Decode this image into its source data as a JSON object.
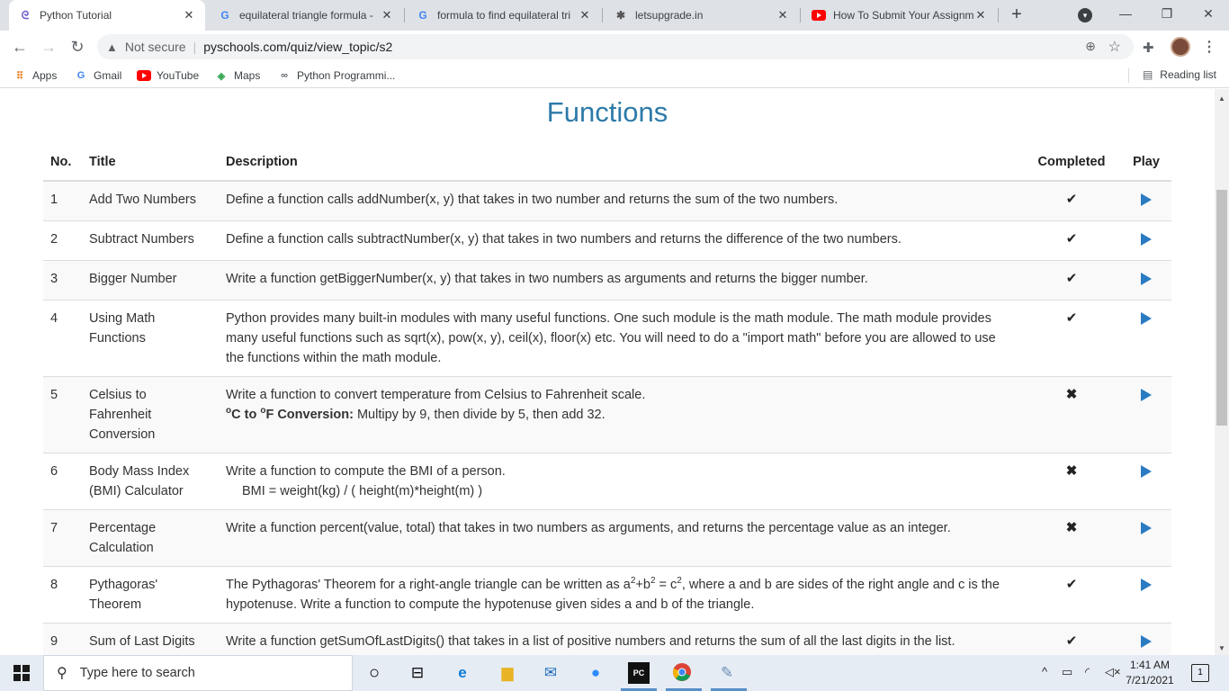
{
  "browser": {
    "tabs": [
      {
        "title": "Python Tutorial",
        "icon": "pyschools-icon"
      },
      {
        "title": "equilateral triangle formula -",
        "icon": "google-icon"
      },
      {
        "title": "formula to find equilateral tri",
        "icon": "google-icon"
      },
      {
        "title": "letsupgrade.in",
        "icon": "letsupgrade-icon"
      },
      {
        "title": "How To Submit Your Assignm",
        "icon": "youtube-icon"
      }
    ],
    "security_label": "Not secure",
    "url": "pyschools.com/quiz/view_topic/s2",
    "bookmarks": [
      "Apps",
      "Gmail",
      "YouTube",
      "Maps",
      "Python Programmi..."
    ],
    "reading_list": "Reading list"
  },
  "page": {
    "title": "Functions",
    "columns": [
      "No.",
      "Title",
      "Description",
      "Completed",
      "Play"
    ],
    "rows": [
      {
        "no": "1",
        "title": "Add Two Numbers",
        "description": "Define a function calls addNumber(x, y) that takes in two number and returns the sum of the two numbers.",
        "completed": "✔"
      },
      {
        "no": "2",
        "title": "Subtract Numbers",
        "description": "Define a function calls subtractNumber(x, y) that takes in two numbers and returns the difference of the two numbers.",
        "completed": "✔"
      },
      {
        "no": "3",
        "title": "Bigger Number",
        "description": "Write a function getBiggerNumber(x, y) that takes in two numbers as arguments and returns the bigger number.",
        "completed": "✔"
      },
      {
        "no": "4",
        "title": "Using Math Functions",
        "description": "Python provides many built-in modules with many useful functions. One such module is the math module. The math module provides many useful functions such as sqrt(x), pow(x, y), ceil(x), floor(x) etc. You will need to do a \"import math\" before you are allowed to use the functions within the math module.",
        "completed": "✔"
      },
      {
        "no": "5",
        "title": "Celsius to Fahrenheit Conversion",
        "description": "Write a function to convert temperature from Celsius to Fahrenheit scale.",
        "description2_bold_pre": "o",
        "description2_bold_a": "C to ",
        "description2_bold_b": "o",
        "description2_bold_c": "F Conversion:",
        "description2_rest": " Multipy by 9, then divide by 5, then add 32.",
        "completed": "✖"
      },
      {
        "no": "6",
        "title": "Body Mass Index (BMI) Calculator",
        "description": "Write a function to compute the BMI of a person.",
        "description2": "BMI = weight(kg)  /  ( height(m)*height(m) )",
        "completed": "✖"
      },
      {
        "no": "7",
        "title": "Percentage Calculation",
        "description": "Write a function percent(value, total) that takes in two numbers as arguments, and returns the percentage value as an integer.",
        "completed": "✖"
      },
      {
        "no": "8",
        "title": "Pythagoras' Theorem",
        "description_a": "The Pythagoras' Theorem for a right-angle triangle can be written as a",
        "sup1": "2",
        "description_b": "+b",
        "sup2": "2",
        "description_c": " = c",
        "sup3": "2",
        "description_d": ", where a and b are sides of the right angle and c is the hypotenuse. Write a function to compute the hypotenuse given sides a and b of the triangle.",
        "completed": "✔"
      },
      {
        "no": "9",
        "title": "Sum of Last Digits",
        "description": "Write a function getSumOfLastDigits() that takes in a list of positive numbers and returns the sum of all the last digits in the list.",
        "completed": "✔"
      }
    ]
  },
  "taskbar": {
    "search_placeholder": "Type here to search",
    "time": "1:41 AM",
    "date": "7/21/2021",
    "notification_count": "1"
  },
  "colors": {
    "heading": "#2d7aa8",
    "play": "#2a7bc1"
  }
}
